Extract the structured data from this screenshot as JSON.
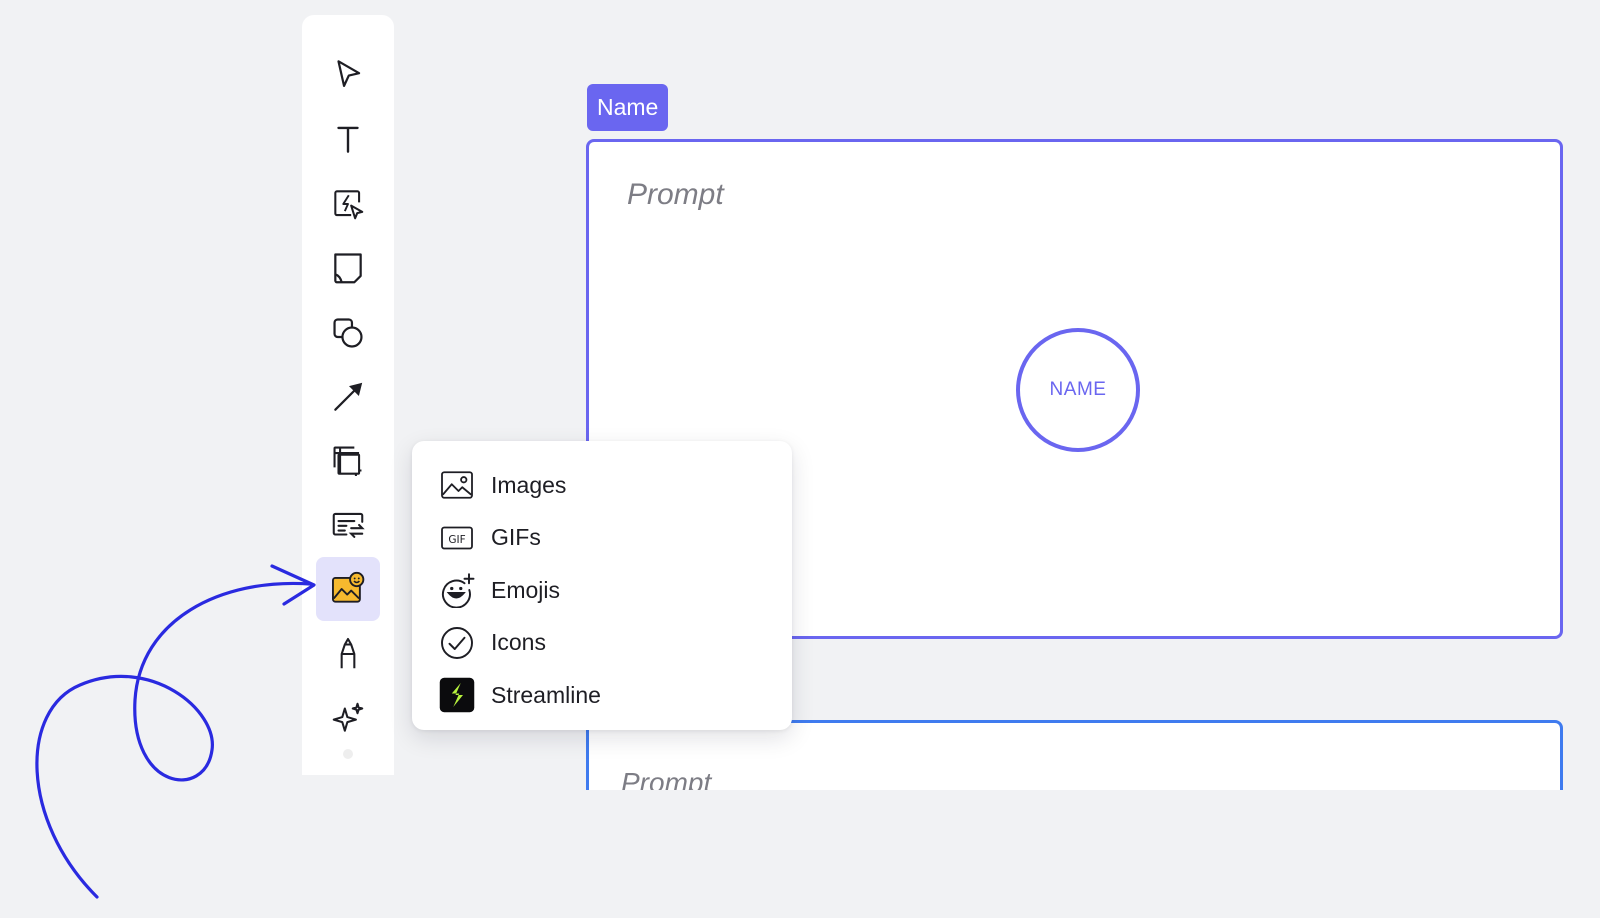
{
  "toolbar": {
    "tools": [
      {
        "name": "select",
        "icon": "cursor-arrow-icon"
      },
      {
        "name": "text",
        "icon": "text-icon"
      },
      {
        "name": "ai-select",
        "icon": "ai-cursor-icon"
      },
      {
        "name": "sticky-note",
        "icon": "sticky-note-icon"
      },
      {
        "name": "shapes",
        "icon": "shapes-icon"
      },
      {
        "name": "connector",
        "icon": "arrow-line-icon"
      },
      {
        "name": "frame",
        "icon": "frame-icon"
      },
      {
        "name": "templates",
        "icon": "templates-icon"
      },
      {
        "name": "media",
        "icon": "media-icon",
        "active": true
      },
      {
        "name": "pen",
        "icon": "pen-icon"
      },
      {
        "name": "ai-magic",
        "icon": "sparkles-icon"
      }
    ]
  },
  "canvas": {
    "frame_label": "Name",
    "frame_prompt": "Prompt",
    "circle_label": "NAME",
    "frame2_prompt": "Prompt"
  },
  "media_menu": {
    "items": [
      {
        "label": "Images",
        "icon": "image-icon"
      },
      {
        "label": "GIFs",
        "icon": "gif-icon"
      },
      {
        "label": "Emojis",
        "icon": "emoji-add-icon"
      },
      {
        "label": "Icons",
        "icon": "check-circle-icon"
      },
      {
        "label": "Streamline",
        "icon": "streamline-logo-icon"
      }
    ]
  },
  "colors": {
    "accent": "#6a66f0",
    "active_tool_bg": "#e3e2fb",
    "annotation_arrow": "#2a2ae0",
    "canvas_bg": "#f1f2f4"
  }
}
